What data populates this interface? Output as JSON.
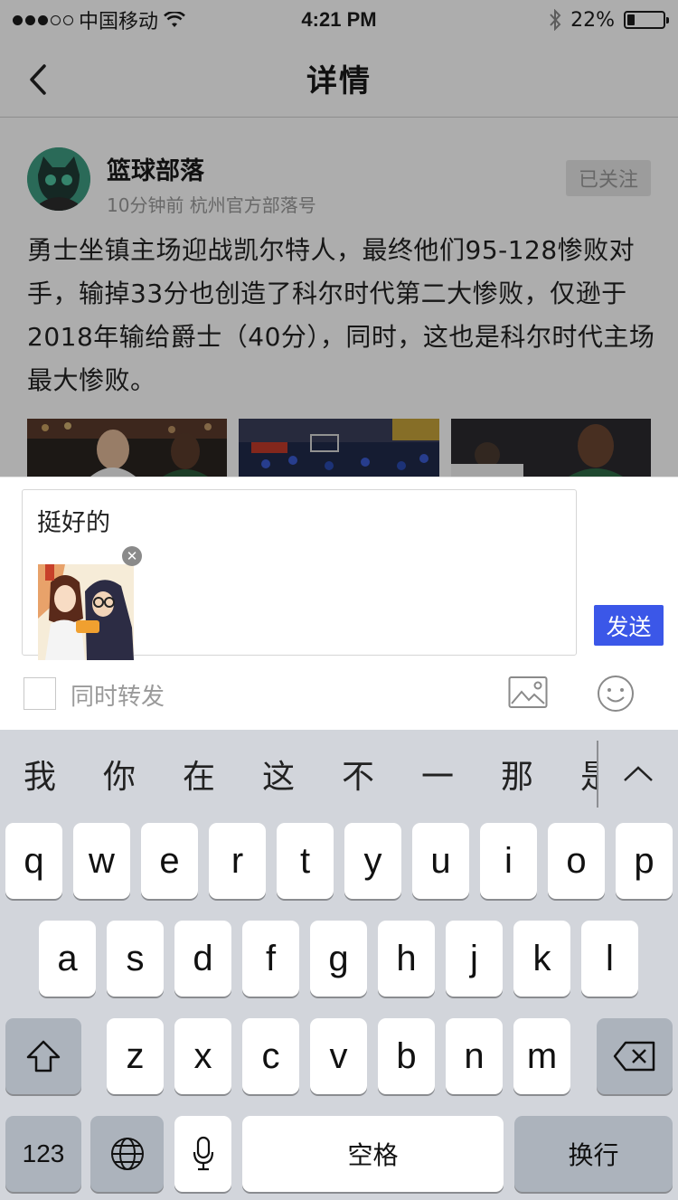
{
  "status_bar": {
    "carrier": "中国移动",
    "time": "4:21 PM",
    "battery": "22%",
    "battery_level": 0.22,
    "signal_bars_filled": 3,
    "signal_bars_total": 5
  },
  "nav": {
    "back_icon": "chevron-left-icon",
    "title": "详情"
  },
  "post": {
    "author": "篮球部落",
    "meta": "10分钟前 杭州官方部落号",
    "follow_label": "已关注",
    "text": "勇士坐镇主场迎战凯尔特人，最终他们95-128惨败对手，输掉33分也创造了科尔时代第二大惨败，仅逊于2018年输给爵士（40分），同时，这也是科尔时代主场最大惨败。"
  },
  "compose": {
    "text": "挺好的",
    "send_label": "发送",
    "forward_label": "同时转发",
    "forward_checked": false,
    "image_icon": "image-icon",
    "emoji_icon": "emoji-icon",
    "remove_icon": "close-icon"
  },
  "keyboard": {
    "candidates": [
      "我",
      "你",
      "在",
      "这",
      "不",
      "一",
      "那",
      "是"
    ],
    "expand_icon": "chevron-up-icon",
    "row1": [
      "q",
      "w",
      "e",
      "r",
      "t",
      "y",
      "u",
      "i",
      "o",
      "p"
    ],
    "row2": [
      "a",
      "s",
      "d",
      "f",
      "g",
      "h",
      "j",
      "k",
      "l"
    ],
    "row3": [
      "z",
      "x",
      "c",
      "v",
      "b",
      "n",
      "m"
    ],
    "shift_icon": "shift-icon",
    "delete_icon": "delete-icon",
    "numbers_label": "123",
    "globe_icon": "globe-icon",
    "mic_icon": "microphone-icon",
    "space_label": "空格",
    "return_label": "换行"
  },
  "colors": {
    "accent": "#3b57e8",
    "keyboard_bg": "#d2d5db",
    "dark_key": "#acb3bc"
  }
}
